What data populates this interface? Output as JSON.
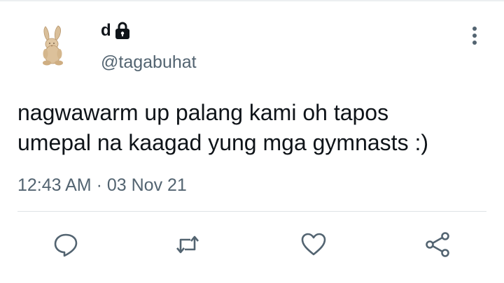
{
  "tweet": {
    "display_name": "d",
    "protected_icon": "lock-icon",
    "handle": "@tagabuhat",
    "text": "nagwawarm up palang kami oh tapos\numepal na kaagad yung mga gymnasts :)",
    "time": "12:43 AM",
    "separator": "·",
    "date": "03 Nov 21"
  },
  "avatar": {
    "icon": "bunny-plush-avatar"
  },
  "actions": [
    {
      "name": "reply",
      "icon": "reply-icon"
    },
    {
      "name": "retweet",
      "icon": "retweet-icon"
    },
    {
      "name": "like",
      "icon": "heart-icon"
    },
    {
      "name": "share",
      "icon": "share-icon"
    }
  ],
  "colors": {
    "text": "#0f1419",
    "secondary": "#536471",
    "divider": "#dfe3e6",
    "icon": "#536471"
  }
}
